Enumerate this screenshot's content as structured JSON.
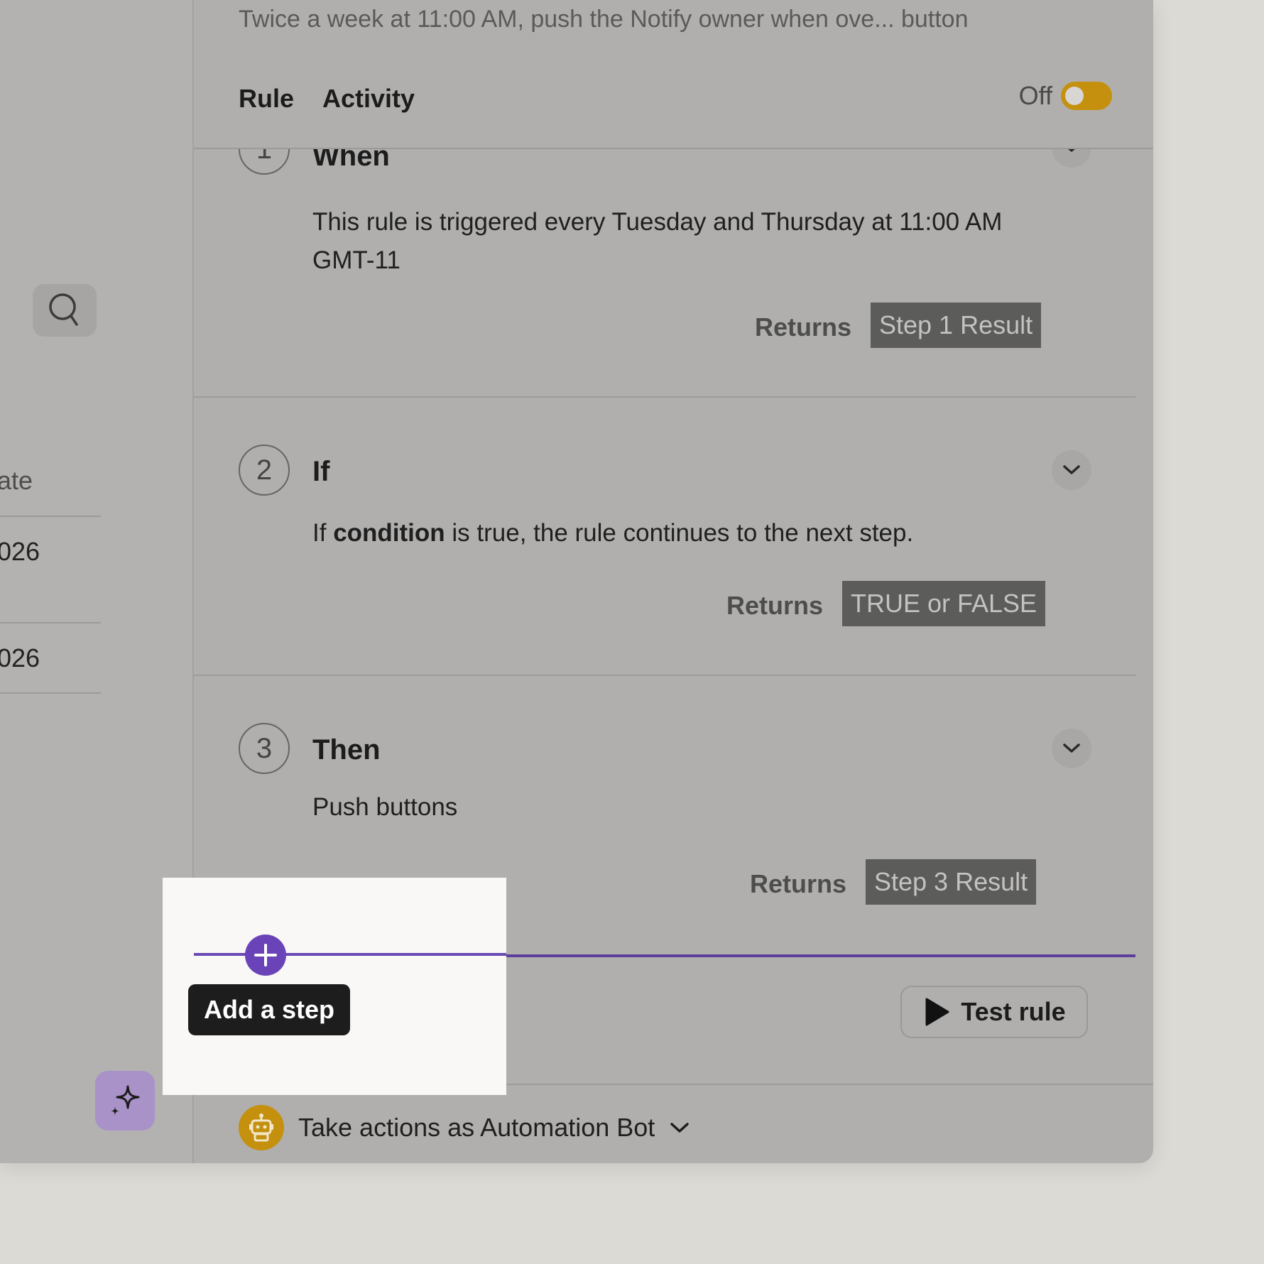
{
  "header": {
    "subtitle": "Twice a week at 11:00 AM, push the Notify owner when ove... button",
    "tabs": [
      {
        "label": "Rule"
      },
      {
        "label": "Activity"
      }
    ],
    "toggle": {
      "label": "Off",
      "state": "off",
      "color": "#c4900e"
    }
  },
  "sidebar": {
    "column_header": "ate",
    "rows": [
      "026",
      "026"
    ]
  },
  "steps": [
    {
      "number": "1",
      "title": "When",
      "description": "This rule is triggered every Tuesday and Thursday at 11:00 AM GMT-11",
      "returns_label": "Returns",
      "result": "Step 1 Result"
    },
    {
      "number": "2",
      "title": "If",
      "desc_prefix": "If ",
      "desc_bold": "condition",
      "desc_suffix": " is true, the rule continues to the next step.",
      "returns_label": "Returns",
      "result": "TRUE or FALSE"
    },
    {
      "number": "3",
      "title": "Then",
      "description": "Push buttons",
      "returns_label": "Returns",
      "result": "Step 3 Result"
    }
  ],
  "add_step_tooltip": "Add a step",
  "test_rule_label": "Test rule",
  "actor_label": "Take actions as Automation Bot",
  "colors": {
    "accent": "#6a43b8",
    "toggle": "#c4900e",
    "badge": "#5c5c5b"
  }
}
